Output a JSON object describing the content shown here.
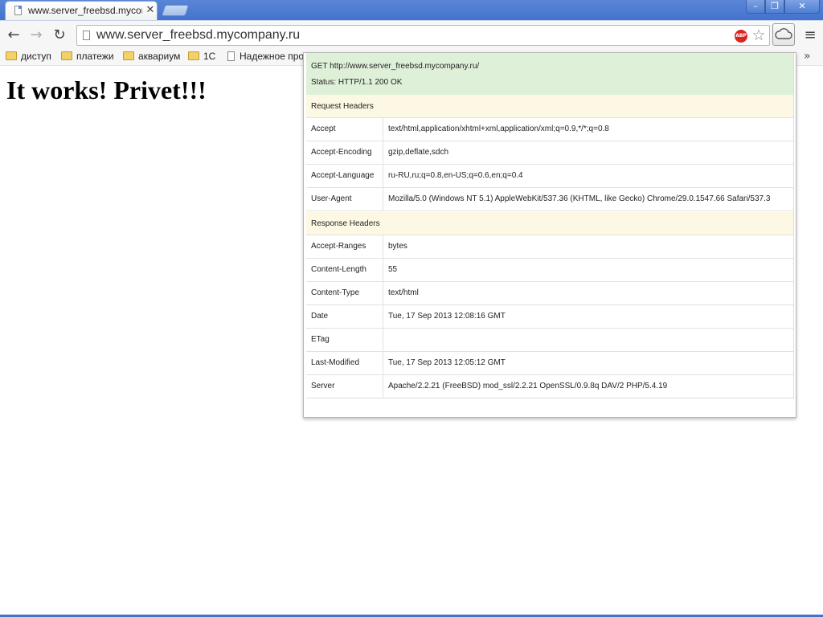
{
  "browser": {
    "tab_title": "www.server_freebsd.mycompany.ru",
    "tab_close": "✕",
    "url": "www.server_freebsd.mycompany.ru",
    "abp_label": "ABP",
    "window_buttons": {
      "minimize": "–",
      "maximize": "❐",
      "close": "✕"
    },
    "nav": {
      "back": "←",
      "forward": "→",
      "reload": "↻",
      "star": "☆",
      "menu": "≡"
    }
  },
  "bookmarks": {
    "items": [
      {
        "label": "диступ",
        "kind": "folder"
      },
      {
        "label": "платежи",
        "kind": "folder"
      },
      {
        "label": "аквариум",
        "kind": "folder"
      },
      {
        "label": "1С",
        "kind": "folder"
      },
      {
        "label": "Надежное прое",
        "kind": "page"
      }
    ],
    "more": "»"
  },
  "page": {
    "heading": "It works! Privet!!!"
  },
  "popup": {
    "method": "GET",
    "request_url": "http://www.server_freebsd.mycompany.ru/",
    "status_label": "Status:",
    "status_value": "HTTP/1.1 200 OK",
    "request_section": "Request Headers",
    "request_headers": [
      {
        "name": "Accept",
        "value": "text/html,application/xhtml+xml,application/xml;q=0.9,*/*;q=0.8"
      },
      {
        "name": "Accept-Encoding",
        "value": "gzip,deflate,sdch"
      },
      {
        "name": "Accept-Language",
        "value": "ru-RU,ru;q=0.8,en-US;q=0.6,en;q=0.4"
      },
      {
        "name": "User-Agent",
        "value": "Mozilla/5.0 (Windows NT 5.1) AppleWebKit/537.36 (KHTML, like Gecko) Chrome/29.0.1547.66 Safari/537.3"
      }
    ],
    "response_section": "Response Headers",
    "response_headers": [
      {
        "name": "Accept-Ranges",
        "value": "bytes"
      },
      {
        "name": "Content-Length",
        "value": "55"
      },
      {
        "name": "Content-Type",
        "value": "text/html"
      },
      {
        "name": "Date",
        "value": "Tue, 17 Sep 2013 12:08:16 GMT"
      },
      {
        "name": "ETag",
        "value": ""
      },
      {
        "name": "Last-Modified",
        "value": "Tue, 17 Sep 2013 12:05:12 GMT"
      },
      {
        "name": "Server",
        "value": "Apache/2.2.21 (FreeBSD) mod_ssl/2.2.21 OpenSSL/0.9.8q DAV/2 PHP/5.4.19"
      }
    ]
  }
}
